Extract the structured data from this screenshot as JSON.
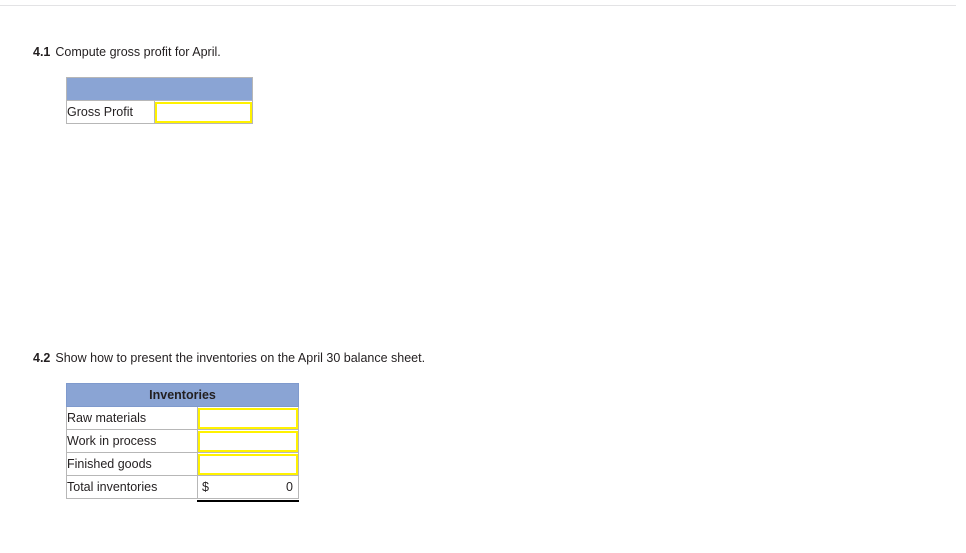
{
  "page": {
    "background": "#ffffff",
    "accent_header_color": "#8aa4d4",
    "input_border_color": "#fff200",
    "text_color": "#231f20"
  },
  "questions": [
    {
      "number": "4.1",
      "text": "Compute gross profit for April."
    },
    {
      "number": "4.2",
      "text": "Show how to present the inventories on the April 30 balance sheet."
    }
  ],
  "gross_profit_table": {
    "header_label": "",
    "rows": [
      {
        "label": "Gross Profit",
        "value": "",
        "placeholder": ""
      }
    ]
  },
  "inventories_table": {
    "header_label": "Inventories",
    "rows": [
      {
        "label": "Raw materials",
        "value": "",
        "placeholder": ""
      },
      {
        "label": "Work in process",
        "value": "",
        "placeholder": ""
      },
      {
        "label": "Finished goods",
        "value": "",
        "placeholder": ""
      }
    ],
    "total_row": {
      "label": "Total inventories",
      "currency_symbol": "$",
      "value": "0"
    }
  }
}
